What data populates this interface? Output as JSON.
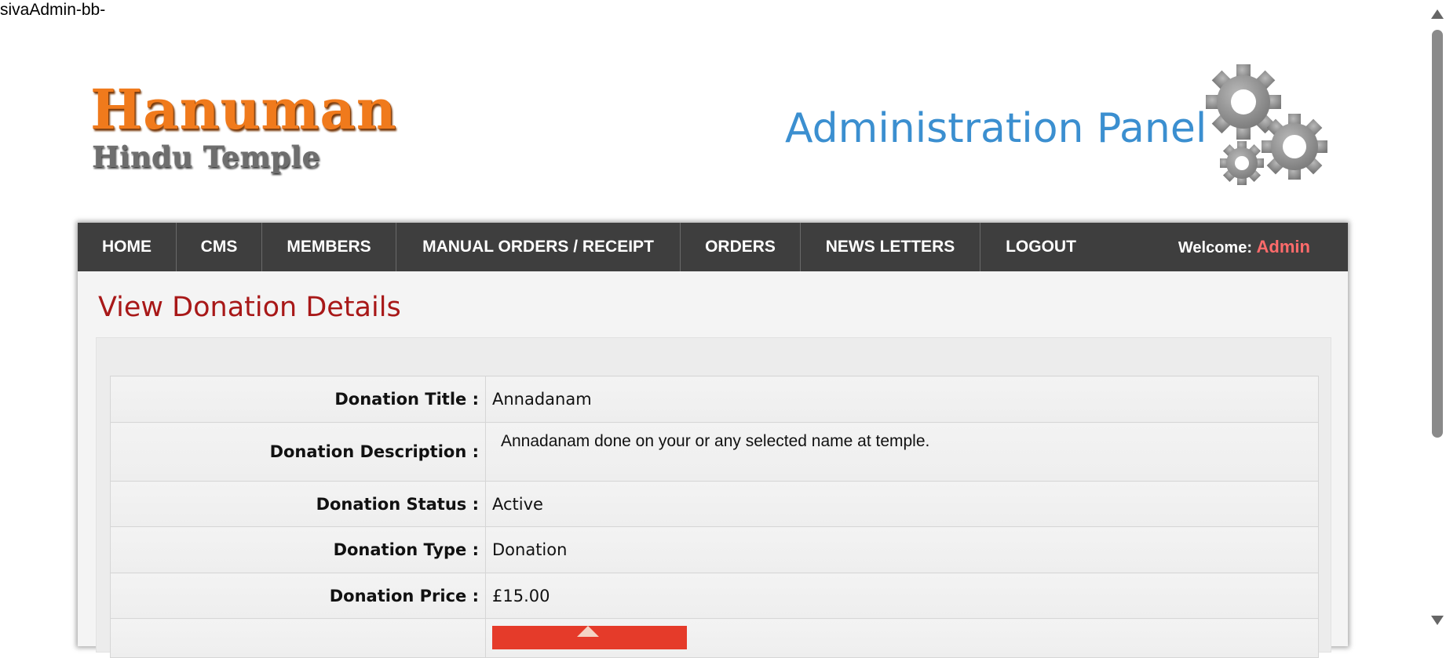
{
  "top_text": "sivaAdmin-bb-",
  "logo": {
    "main": "Hanuman",
    "sub": "Hindu Temple"
  },
  "header": {
    "admin_title": "Administration Panel",
    "gears_icon": "gears-icon"
  },
  "nav": {
    "items": [
      {
        "label": "HOME"
      },
      {
        "label": "CMS"
      },
      {
        "label": "MEMBERS"
      },
      {
        "label": "MANUAL ORDERS / RECEIPT"
      },
      {
        "label": "ORDERS"
      },
      {
        "label": "NEWS LETTERS"
      },
      {
        "label": "LOGOUT"
      }
    ],
    "welcome_label": "Welcome:",
    "welcome_name": "Admin"
  },
  "page": {
    "title": "View Donation Details"
  },
  "details": {
    "rows": [
      {
        "label": "Donation Title :",
        "value": "Annadanam"
      },
      {
        "label": "Donation Description :",
        "value": "Annadanam done on your  or any selected name at temple."
      },
      {
        "label": "Donation Status :",
        "value": "Active"
      },
      {
        "label": "Donation Type :",
        "value": "Donation"
      },
      {
        "label": "Donation Price :",
        "value": "£15.00"
      }
    ]
  },
  "colors": {
    "nav_bg": "#3e3e3e",
    "title_red": "#a81818",
    "admin_blue": "#3b8fd0",
    "logo_orange": "#f07a1c",
    "welcome_name": "#ff6b6b"
  }
}
